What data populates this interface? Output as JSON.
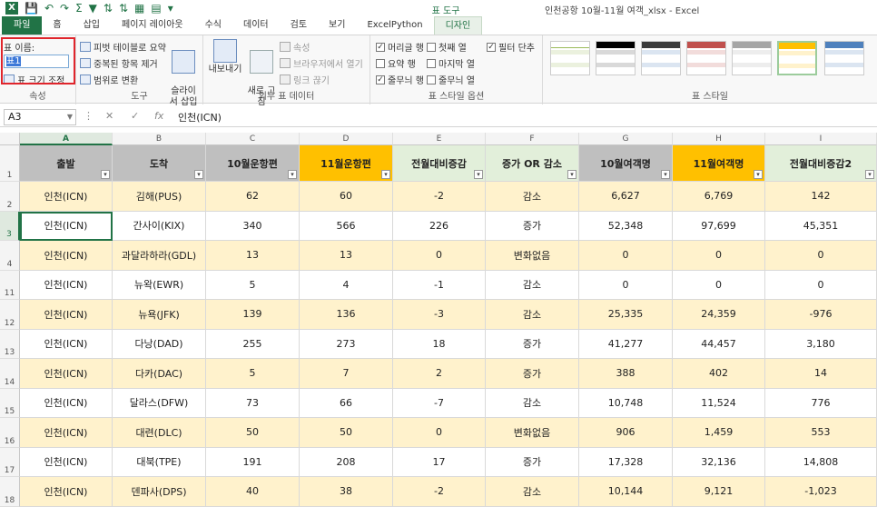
{
  "window": {
    "title": "인천공항 10월-11월 여객_xlsx - Excel",
    "context_tool": "표 도구"
  },
  "tabs": [
    "파일",
    "홈",
    "삽입",
    "페이지 레이아웃",
    "수식",
    "데이터",
    "검토",
    "보기",
    "ExcelPython",
    "디자인"
  ],
  "ribbon": {
    "properties": {
      "table_name_label": "표 이름:",
      "table_name_value": "표1",
      "resize_label": "표 크기 조정",
      "group_label": "속성"
    },
    "tools": {
      "pivot": "피벗 테이블로 요약",
      "remove_dup": "중복된 항목 제거",
      "convert_range": "범위로 변환",
      "slicer": "슬라이\n서 삽입",
      "group_label": "도구"
    },
    "external": {
      "export": "내보내기",
      "refresh": "새로 고\n침",
      "properties": "속성",
      "open_browser": "브라우저에서 열기",
      "unlink": "링크 끊기",
      "group_label": "외부 표 데이터"
    },
    "style_options": {
      "header_row": "머리글 행",
      "first_col": "첫째 열",
      "filter_button": "필터 단추",
      "total_row": "요약 행",
      "last_col": "마지막 열",
      "banded_rows": "줄무늬 행",
      "banded_cols": "줄무늬 열",
      "group_label": "표 스타일 옵션"
    },
    "styles": {
      "group_label": "표 스타일"
    }
  },
  "formula_bar": {
    "name_box": "A3",
    "fx": "fx",
    "content": "인천(ICN)"
  },
  "columns": [
    "A",
    "B",
    "C",
    "D",
    "E",
    "F",
    "G",
    "H",
    "I"
  ],
  "active_column": "A",
  "table": {
    "headers": [
      "출발",
      "도착",
      "10월운항편",
      "11월운항편",
      "전월대비증감",
      "증가 OR 감소",
      "10월여객명",
      "11월여객명",
      "전월대비증감2"
    ],
    "rows": [
      {
        "row_num": "2",
        "cells": [
          "인천(ICN)",
          "김해(PUS)",
          "62",
          "60",
          "-2",
          "감소",
          "6,627",
          "6,769",
          "142"
        ]
      },
      {
        "row_num": "3",
        "cells": [
          "인천(ICN)",
          "간사이(KIX)",
          "340",
          "566",
          "226",
          "증가",
          "52,348",
          "97,699",
          "45,351"
        ]
      },
      {
        "row_num": "4",
        "cells": [
          "인천(ICN)",
          "과달라하라(GDL)",
          "13",
          "13",
          "0",
          "변화없음",
          "0",
          "0",
          "0"
        ]
      },
      {
        "row_num": "11",
        "cells": [
          "인천(ICN)",
          "뉴왁(EWR)",
          "5",
          "4",
          "-1",
          "감소",
          "0",
          "0",
          "0"
        ]
      },
      {
        "row_num": "12",
        "cells": [
          "인천(ICN)",
          "뉴욕(JFK)",
          "139",
          "136",
          "-3",
          "감소",
          "25,335",
          "24,359",
          "-976"
        ]
      },
      {
        "row_num": "13",
        "cells": [
          "인천(ICN)",
          "다낭(DAD)",
          "255",
          "273",
          "18",
          "증가",
          "41,277",
          "44,457",
          "3,180"
        ]
      },
      {
        "row_num": "14",
        "cells": [
          "인천(ICN)",
          "다카(DAC)",
          "5",
          "7",
          "2",
          "증가",
          "388",
          "402",
          "14"
        ]
      },
      {
        "row_num": "15",
        "cells": [
          "인천(ICN)",
          "달라스(DFW)",
          "73",
          "66",
          "-7",
          "감소",
          "10,748",
          "11,524",
          "776"
        ]
      },
      {
        "row_num": "16",
        "cells": [
          "인천(ICN)",
          "대련(DLC)",
          "50",
          "50",
          "0",
          "변화없음",
          "906",
          "1,459",
          "553"
        ]
      },
      {
        "row_num": "17",
        "cells": [
          "인천(ICN)",
          "대북(TPE)",
          "191",
          "208",
          "17",
          "증가",
          "17,328",
          "32,136",
          "14,808"
        ]
      },
      {
        "row_num": "18",
        "cells": [
          "인천(ICN)",
          "덴파사(DPS)",
          "40",
          "38",
          "-2",
          "감소",
          "10,144",
          "9,121",
          "-1,023"
        ]
      }
    ]
  },
  "colors": {
    "excel_green": "#217346",
    "header_gray": "#bfbfbf",
    "header_orange": "#ffc000",
    "header_green_light": "#e2efda",
    "band_yellow": "#fff2cc",
    "highlight_red": "#e0252c"
  }
}
